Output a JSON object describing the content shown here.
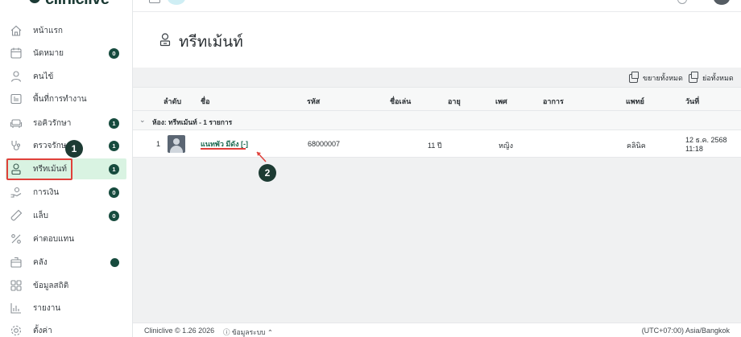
{
  "app": {
    "logo": "cliniclive"
  },
  "sidebar": {
    "items": [
      {
        "label": "หน้าแรก",
        "icon": "home-icon"
      },
      {
        "label": "นัดหมาย",
        "icon": "calendar-icon",
        "badge": "0"
      },
      {
        "label": "คนไข้",
        "icon": "person-icon"
      },
      {
        "label": "พื้นที่การทำงาน",
        "icon": "workspace-icon"
      },
      {
        "label": "รอคิวรักษา",
        "icon": "waiting-chair-icon",
        "badge": "1"
      },
      {
        "label": "ตรวจรักษา",
        "icon": "stethoscope-icon",
        "badge": "1"
      },
      {
        "label": "ทรีทเม้นท์",
        "icon": "treatment-icon",
        "badge": "1",
        "active": true
      },
      {
        "label": "การเงิน",
        "icon": "payment-hand-icon",
        "badge": "0"
      },
      {
        "label": "แล็บ",
        "icon": "lab-tube-icon",
        "badge": "0"
      },
      {
        "label": "ค่าตอบแทน",
        "icon": "percent-icon"
      },
      {
        "label": "คลัง",
        "icon": "inventory-box-icon",
        "dot": true
      },
      {
        "label": "ข้อมูลสถิติ",
        "icon": "stats-grid-icon"
      },
      {
        "label": "รายงาน",
        "icon": "report-chart-icon"
      },
      {
        "label": "ตั้งค่า",
        "icon": "settings-gear-icon"
      }
    ]
  },
  "annotations": {
    "step1": "1",
    "step2": "2"
  },
  "page": {
    "title": "ทรีทเม้นท์"
  },
  "toolbar": {
    "expand_all": "ขยายทั้งหมด",
    "collapse_all": "ย่อทั้งหมด"
  },
  "table": {
    "columns": [
      "ลำดับ",
      "ชื่อ",
      "รหัส",
      "ชื่อเล่น",
      "อายุ",
      "เพศ",
      "อาการ",
      "แพทย์",
      "วันที่"
    ],
    "group": {
      "label": "ห้อง: ทรีทเม้นท์ - 1 รายการ"
    },
    "rows": [
      {
        "index": "1",
        "name": "แนทพัว มีดัง [-]",
        "code": "68000007",
        "nickname": "",
        "age": "11 ปี",
        "gender": "หญิง",
        "symptom": "",
        "doctor": "คลินิค",
        "date": "12 ธ.ค. 2568",
        "time": "11:18"
      }
    ]
  },
  "footer": {
    "version": "Cliniclive © 1.26 2026",
    "system_info": "ⓘ ข้อมูลระบบ ⌃",
    "timezone": "(UTC+07:00) Asia/Bangkok"
  },
  "colors": {
    "brand": "#174b3e",
    "active_bg": "#d9f3e2",
    "annotation_red": "#e0403a",
    "link": "#1f6b52"
  }
}
